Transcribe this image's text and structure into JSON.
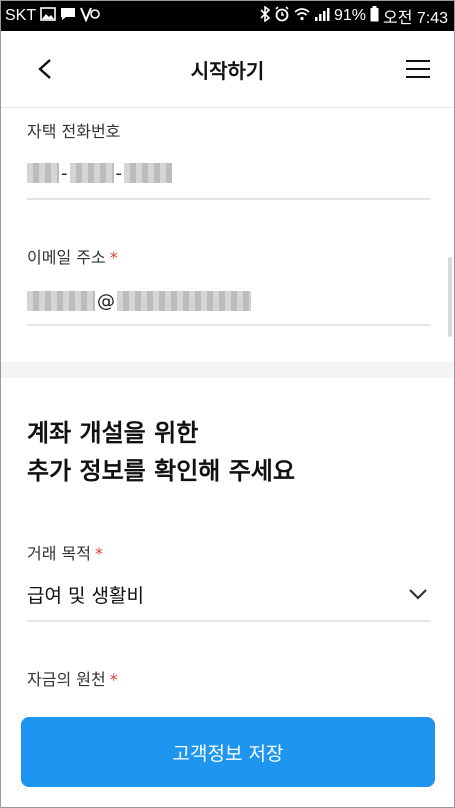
{
  "status_bar": {
    "carrier": "SKT",
    "battery": "91%",
    "time": "오전 7:43"
  },
  "header": {
    "title": "시작하기",
    "back_icon": "chevron-left-icon",
    "menu_icon": "hamburger-icon"
  },
  "fields": {
    "home_phone_label": "자택 전화번호",
    "email_label": "이메일 주소",
    "email_at": "@",
    "required_mark": "*"
  },
  "section": {
    "heading_line1": "계좌 개설을 위한",
    "heading_line2": "추가 정보를 확인해 주세요"
  },
  "purpose": {
    "label": "거래 목적",
    "value": "급여 및 생활비"
  },
  "funds_source": {
    "label": "자금의 원천"
  },
  "save_button": "고객정보 저장",
  "colors": {
    "primary": "#1e96f0",
    "required": "#e53935"
  }
}
